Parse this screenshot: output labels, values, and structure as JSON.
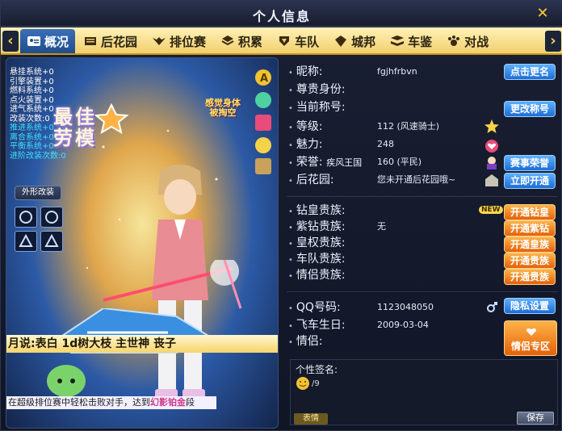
{
  "window": {
    "title": "个人信息",
    "close_symbol": "✕"
  },
  "tabs": [
    {
      "label": "概况",
      "icon": "profile-card-icon",
      "active": true
    },
    {
      "label": "后花园",
      "icon": "garden-icon"
    },
    {
      "label": "排位赛",
      "icon": "rank-wings-icon"
    },
    {
      "label": "积累",
      "icon": "stack-icon"
    },
    {
      "label": "车队",
      "icon": "team-icon"
    },
    {
      "label": "城邦",
      "icon": "city-icon"
    },
    {
      "label": "车鉴",
      "icon": "book-icon"
    },
    {
      "label": "对战",
      "icon": "paw-icon"
    }
  ],
  "left_panel": {
    "stats": [
      {
        "text": "悬挂系统+0",
        "cyan": false
      },
      {
        "text": "引擎装置+0",
        "cyan": false
      },
      {
        "text": "燃料系统+0",
        "cyan": false
      },
      {
        "text": "点火装置+0",
        "cyan": false
      },
      {
        "text": "进气系统+0",
        "cyan": false
      },
      {
        "text": "改装次数:0",
        "cyan": false
      },
      {
        "text": "推进系统+0",
        "cyan": true
      },
      {
        "text": "离合系统+0",
        "cyan": true
      },
      {
        "text": "平衡系统+0",
        "cyan": true
      },
      {
        "text": "进阶改装次数:0",
        "cyan": true
      }
    ],
    "appearance_button": "外形改装",
    "badge_text": "最佳\n劳模",
    "promo_text": "感觉身体\n被掏空",
    "marquee": "月说:表白 1d树大枝 主世神 丧子",
    "notice_prefix": "在超级排位赛中轻松击败对手，达到",
    "notice_highlight": "幻影铂金",
    "notice_suffix": "段"
  },
  "profile": {
    "nickname_label": "昵称:",
    "nickname": "fgjhfrbvn",
    "nickname_button": "点击更名",
    "identity_label": "尊贵身份:",
    "title_label": "当前称号:",
    "title_button": "更改称号",
    "level_label": "等级:",
    "level_value": "112 (风速骑士)",
    "charm_label": "魅力:",
    "charm_value": "248",
    "honor_label": "荣誉:",
    "honor_extra": "疾风王国",
    "honor_value": "160 (平民)",
    "honor_button": "赛事荣誉",
    "garden_label": "后花园:",
    "garden_value": "您未开通后花园哦~",
    "garden_button": "立即开通",
    "diamond_label": "钻皇贵族:",
    "diamond_button": "开通钻皇",
    "new_badge": "NEW",
    "purple_label": "紫钻贵族:",
    "purple_value": "无",
    "purple_button": "开通紫钻",
    "royal_label": "皇权贵族:",
    "royal_button": "开通皇族",
    "team_label": "车队贵族:",
    "team_button": "开通贵族",
    "couple_label": "情侣贵族:",
    "couple_button": "开通贵族",
    "qq_label": "QQ号码:",
    "qq_value": "1123048050",
    "privacy_button": "隐私设置",
    "birthday_label": "飞车生日:",
    "birthday_value": "2009-03-04",
    "couple_info_label": "情侣:",
    "couple_zone_button": "情侣专区",
    "signature_label": "个性签名:",
    "signature_count": "/9",
    "emoji_button": "表情",
    "save_button": "保存"
  },
  "colors": {
    "accent_blue": "#1d6cd6",
    "accent_orange": "#e2620c",
    "tab_bar": "#f2cf6d",
    "cyan_text": "#3fe0ff"
  }
}
